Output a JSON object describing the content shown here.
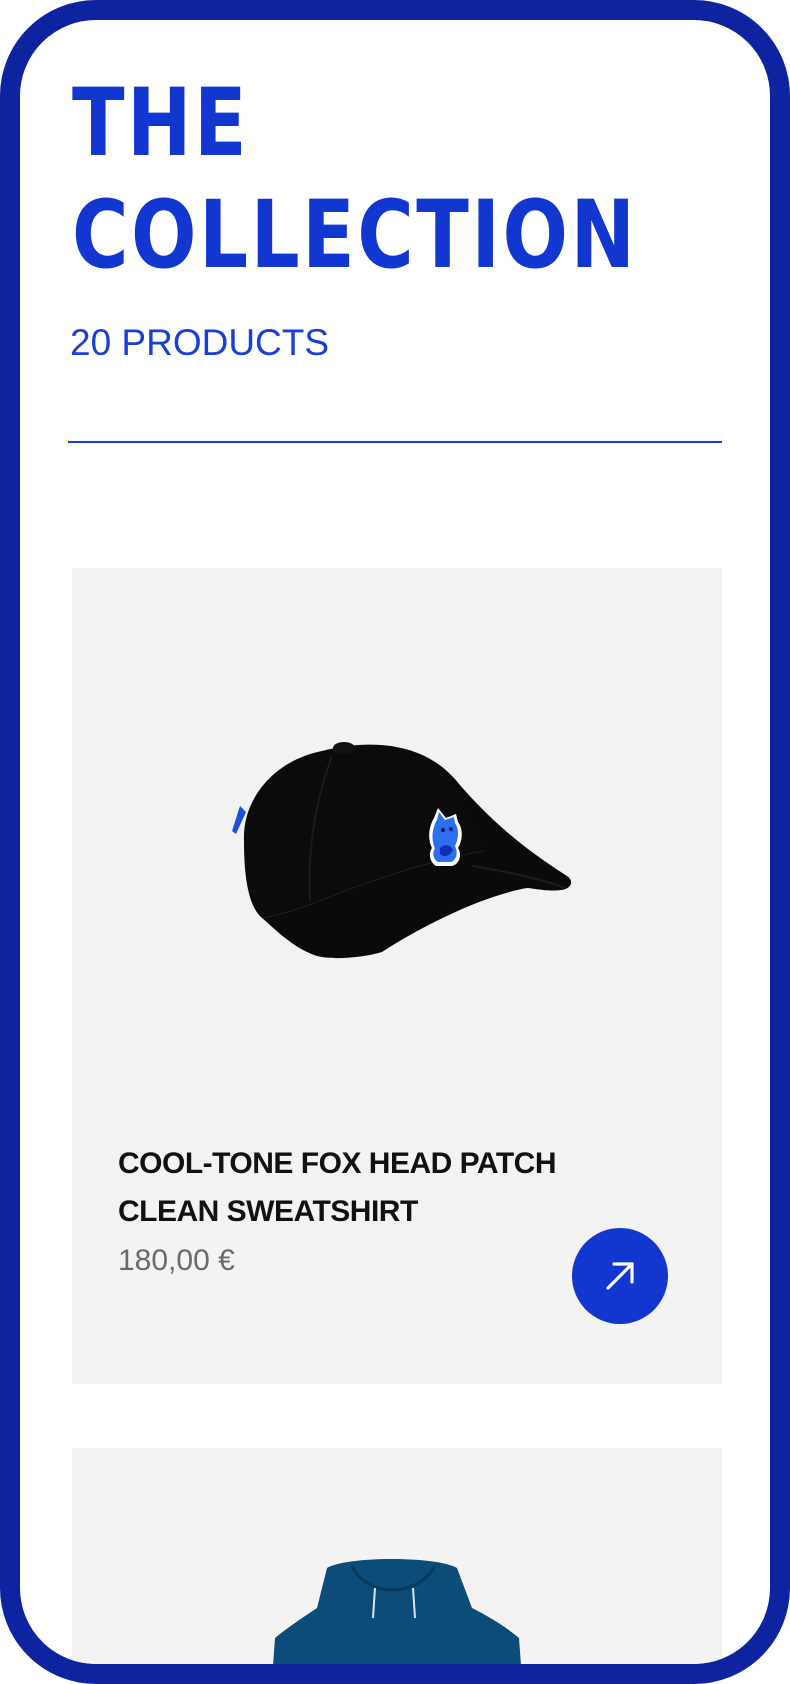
{
  "header": {
    "title_line1": "THE",
    "title_line2": "COLLECTION",
    "product_count": "20 PRODUCTS"
  },
  "products": [
    {
      "name": "COOL-TONE FOX HEAD PATCH CLEAN SWEATSHIRT",
      "price": "180,00 €",
      "image_icon": "cap-with-fox-patch",
      "action_icon": "arrow-up-right-icon"
    },
    {
      "image_icon": "hoodie"
    }
  ],
  "colors": {
    "frame": "#0d23a0",
    "accent": "#1237d0",
    "card_background": "#f3f3f3"
  }
}
